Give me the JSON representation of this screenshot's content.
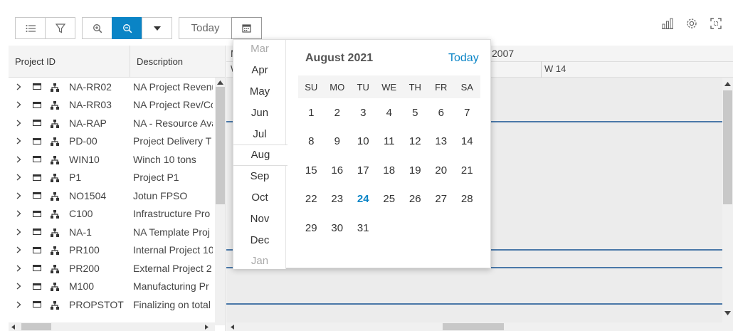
{
  "toolbar": {
    "today_label": "Today"
  },
  "grid": {
    "headers": {
      "project_id": "Project ID",
      "description": "Description"
    },
    "rows": [
      {
        "id": "NA-RR02",
        "desc": "NA Project Revenu"
      },
      {
        "id": "NA-RR03",
        "desc": "NA Project Rev/Co"
      },
      {
        "id": "NA-RAP",
        "desc": "NA - Resource Ava"
      },
      {
        "id": "PD-00",
        "desc": "Project Delivery T"
      },
      {
        "id": "WIN10",
        "desc": "Winch 10 tons"
      },
      {
        "id": "P1",
        "desc": "Project P1"
      },
      {
        "id": "NO1504",
        "desc": "Jotun FPSO"
      },
      {
        "id": "C100",
        "desc": "Infrastructure Pro"
      },
      {
        "id": "NA-1",
        "desc": "NA Template Proj"
      },
      {
        "id": "PR100",
        "desc": "Internal Project 10"
      },
      {
        "id": "PR200",
        "desc": "External Project 2"
      },
      {
        "id": "M100",
        "desc": "Manufacturing Pr"
      },
      {
        "id": "PROPSTOT",
        "desc": "Finalizing on total"
      }
    ]
  },
  "gantt": {
    "year_label": "2007",
    "week_label": "W 14",
    "clipped_month_letter": "M",
    "clipped_week_letter": "W"
  },
  "calendar": {
    "title": "August 2021",
    "today_label": "Today",
    "months": [
      "Mar",
      "Apr",
      "May",
      "Jun",
      "Jul",
      "Aug",
      "Sep",
      "Oct",
      "Nov",
      "Dec",
      "Jan"
    ],
    "selected_month": "Aug",
    "weekdays": [
      "SU",
      "MO",
      "TU",
      "WE",
      "TH",
      "FR",
      "SA"
    ],
    "weeks": [
      [
        "1",
        "2",
        "3",
        "4",
        "5",
        "6",
        "7"
      ],
      [
        "8",
        "9",
        "10",
        "11",
        "12",
        "13",
        "14"
      ],
      [
        "15",
        "16",
        "17",
        "18",
        "19",
        "20",
        "21"
      ],
      [
        "22",
        "23",
        "24",
        "25",
        "26",
        "27",
        "28"
      ],
      [
        "29",
        "30",
        "31",
        "",
        "",
        "",
        ""
      ]
    ],
    "today_day": "24"
  },
  "colors": {
    "accent": "#0a84c6",
    "bar_line": "#4a78a8"
  }
}
